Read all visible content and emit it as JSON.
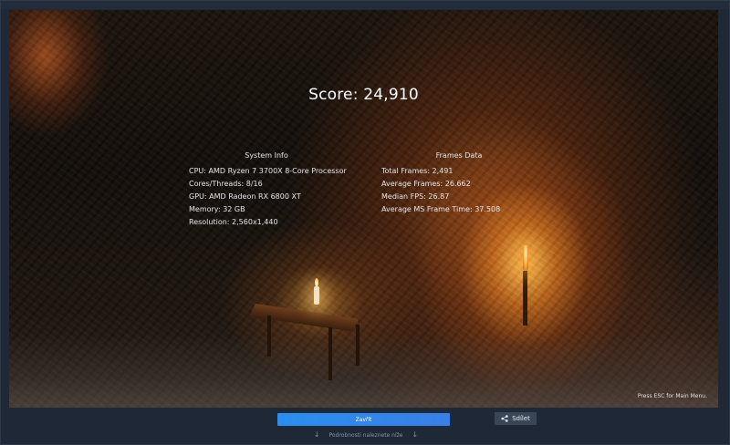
{
  "score": {
    "text": "Score: 24,910"
  },
  "system_info": {
    "title": "System Info",
    "rows": [
      "CPU: AMD Ryzen 7 3700X 8-Core Processor",
      "Cores/Threads: 8/16",
      "GPU: AMD Radeon RX 6800 XT",
      "Memory: 32 GB",
      "Resolution: 2,560x1,440"
    ]
  },
  "frames_data": {
    "title": "Frames Data",
    "rows": [
      "Total Frames: 2,491",
      "Average Frames: 26.662",
      "Median FPS: 26.87",
      "Average MS Frame Time: 37.508"
    ]
  },
  "esc_hint": "Press ESC for Main Menu.",
  "buttons": {
    "close_label": "Zavřít",
    "share_label": "Sdílet"
  },
  "footer": {
    "hint": "Podrobnosti naleznete níže"
  },
  "colors": {
    "accent": "#2a8ff0",
    "share_button": "#3a4658",
    "window_bg": "#1f2836"
  },
  "icons": {
    "share": "share-icon",
    "down_arrow": "arrow-down-icon"
  }
}
